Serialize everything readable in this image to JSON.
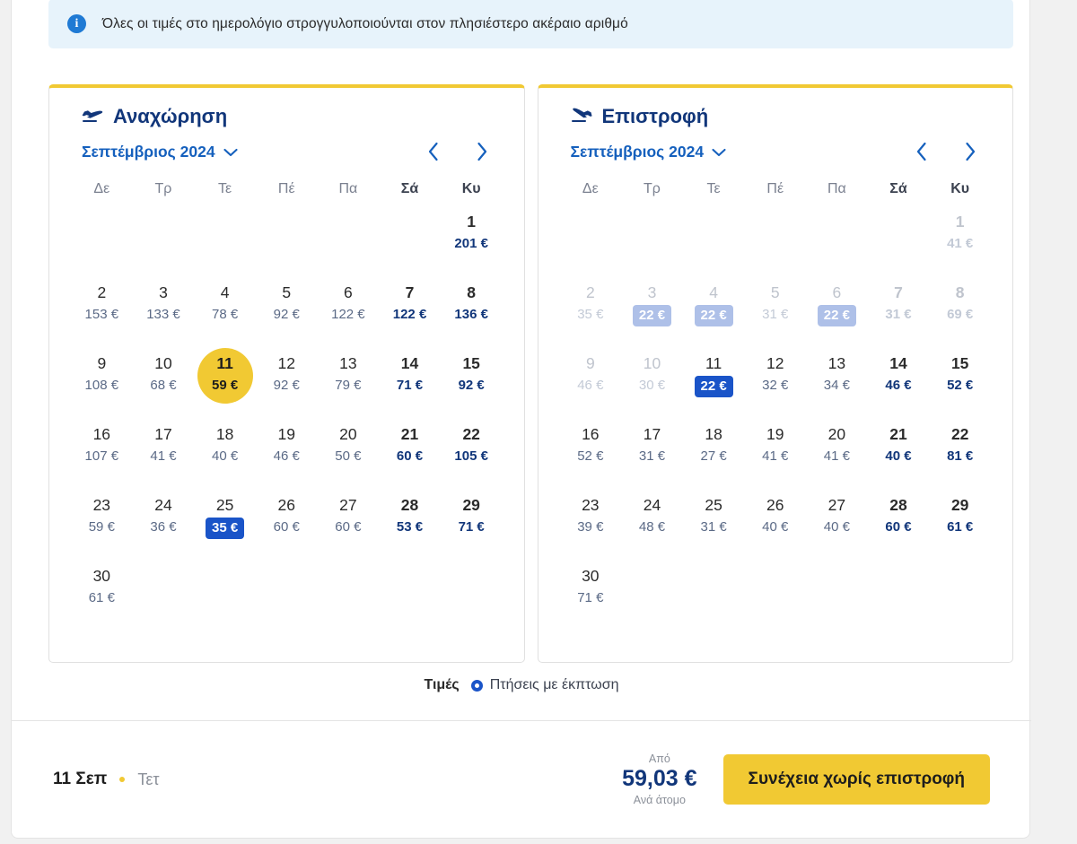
{
  "banner": {
    "icon": "info-icon",
    "text": "Όλες οι τιμές στο ημερολόγιο στρογγυλοποιούνται στον πλησιέστερο ακέραιο αριθμό"
  },
  "weekdays": [
    "Δε",
    "Τρ",
    "Τε",
    "Πέ",
    "Πα",
    "Σά",
    "Κυ"
  ],
  "outbound": {
    "title": "Αναχώρηση",
    "icon": "plane-departure-icon",
    "month": "Σεπτέμβριος 2024",
    "dropdown_icon": "chevron-down-icon",
    "prev_icon": "chevron-left-icon",
    "next_icon": "chevron-right-icon",
    "lead_blanks": 6,
    "days": [
      {
        "num": "1",
        "price": "201 €",
        "weekend": true
      },
      {
        "num": "2",
        "price": "153 €"
      },
      {
        "num": "3",
        "price": "133 €"
      },
      {
        "num": "4",
        "price": "78 €"
      },
      {
        "num": "5",
        "price": "92 €"
      },
      {
        "num": "6",
        "price": "122 €"
      },
      {
        "num": "7",
        "price": "122 €",
        "weekend": true
      },
      {
        "num": "8",
        "price": "136 €",
        "weekend": true
      },
      {
        "num": "9",
        "price": "108 €"
      },
      {
        "num": "10",
        "price": "68 €"
      },
      {
        "num": "11",
        "price": "59 €",
        "selected": true
      },
      {
        "num": "12",
        "price": "92 €"
      },
      {
        "num": "13",
        "price": "79 €"
      },
      {
        "num": "14",
        "price": "71 €",
        "weekend": true
      },
      {
        "num": "15",
        "price": "92 €",
        "weekend": true
      },
      {
        "num": "16",
        "price": "107 €"
      },
      {
        "num": "17",
        "price": "41 €"
      },
      {
        "num": "18",
        "price": "40 €"
      },
      {
        "num": "19",
        "price": "46 €"
      },
      {
        "num": "20",
        "price": "50 €"
      },
      {
        "num": "21",
        "price": "60 €",
        "weekend": true
      },
      {
        "num": "22",
        "price": "105 €",
        "weekend": true
      },
      {
        "num": "23",
        "price": "59 €"
      },
      {
        "num": "24",
        "price": "36 €"
      },
      {
        "num": "25",
        "price": "35 €",
        "badge": true
      },
      {
        "num": "26",
        "price": "60 €"
      },
      {
        "num": "27",
        "price": "60 €"
      },
      {
        "num": "28",
        "price": "53 €",
        "weekend": true
      },
      {
        "num": "29",
        "price": "71 €",
        "weekend": true
      },
      {
        "num": "30",
        "price": "61 €"
      }
    ]
  },
  "inbound": {
    "title": "Επιστροφή",
    "icon": "plane-arrival-icon",
    "month": "Σεπτέμβριος 2024",
    "dropdown_icon": "chevron-down-icon",
    "prev_icon": "chevron-left-icon",
    "next_icon": "chevron-right-icon",
    "lead_blanks": 6,
    "days": [
      {
        "num": "1",
        "price": "41 €",
        "weekend": true,
        "disabled": true
      },
      {
        "num": "2",
        "price": "35 €",
        "disabled": true
      },
      {
        "num": "3",
        "price": "22 €",
        "disabled": true,
        "badge": true
      },
      {
        "num": "4",
        "price": "22 €",
        "disabled": true,
        "badge": true
      },
      {
        "num": "5",
        "price": "31 €",
        "disabled": true
      },
      {
        "num": "6",
        "price": "22 €",
        "disabled": true,
        "badge": true
      },
      {
        "num": "7",
        "price": "31 €",
        "weekend": true,
        "disabled": true
      },
      {
        "num": "8",
        "price": "69 €",
        "weekend": true,
        "disabled": true
      },
      {
        "num": "9",
        "price": "46 €",
        "disabled": true
      },
      {
        "num": "10",
        "price": "30 €",
        "disabled": true
      },
      {
        "num": "11",
        "price": "22 €",
        "badge": true
      },
      {
        "num": "12",
        "price": "32 €"
      },
      {
        "num": "13",
        "price": "34 €"
      },
      {
        "num": "14",
        "price": "46 €",
        "weekend": true
      },
      {
        "num": "15",
        "price": "52 €",
        "weekend": true
      },
      {
        "num": "16",
        "price": "52 €"
      },
      {
        "num": "17",
        "price": "31 €"
      },
      {
        "num": "18",
        "price": "27 €"
      },
      {
        "num": "19",
        "price": "41 €"
      },
      {
        "num": "20",
        "price": "41 €"
      },
      {
        "num": "21",
        "price": "40 €",
        "weekend": true
      },
      {
        "num": "22",
        "price": "81 €",
        "weekend": true
      },
      {
        "num": "23",
        "price": "39 €"
      },
      {
        "num": "24",
        "price": "48 €"
      },
      {
        "num": "25",
        "price": "31 €"
      },
      {
        "num": "26",
        "price": "40 €"
      },
      {
        "num": "27",
        "price": "40 €"
      },
      {
        "num": "28",
        "price": "60 €",
        "weekend": true
      },
      {
        "num": "29",
        "price": "61 €",
        "weekend": true
      },
      {
        "num": "30",
        "price": "71 €"
      }
    ]
  },
  "legend": {
    "label": "Τιμές",
    "discount_text": "Πτήσεις με έκπτωση",
    "ring_icon": "discount-ring-icon"
  },
  "footer": {
    "selected_date": "11 Σεπ",
    "selected_weekday": "Τετ",
    "from_label": "Από",
    "amount": "59,03 €",
    "per_person_label": "Ανά άτομο",
    "cta_label": "Συνέχεια χωρίς επιστροφή"
  },
  "colors": {
    "brand_yellow": "#f1c933",
    "brand_blue": "#11367a",
    "link_blue": "#1560bd",
    "badge_blue": "#1a54c8",
    "badge_blue_disabled": "#aec0e8",
    "info_bg": "#e7f3fb",
    "page_bg": "#f1f1f1"
  }
}
